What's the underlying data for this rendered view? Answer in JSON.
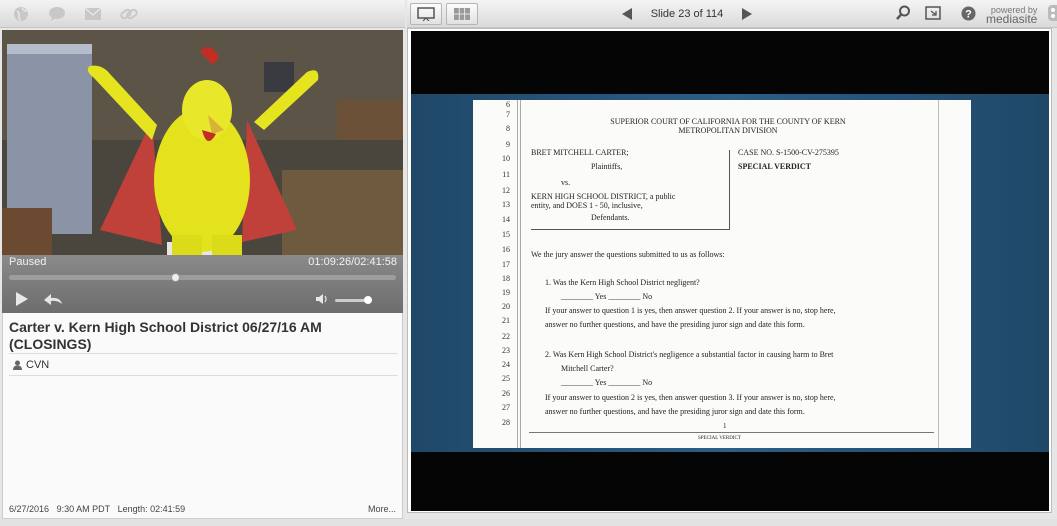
{
  "toolbar_left": {
    "icons": [
      "globe-icon",
      "chat-icon",
      "email-icon",
      "link-icon"
    ]
  },
  "toolbar_right": {
    "slide_label": "Slide 23 of 114",
    "powered_by": "powered by",
    "brand": "mediasite"
  },
  "player": {
    "status": "Paused",
    "time": "01:09:26/02:41:58",
    "progress": 0.43,
    "volume": 0.85
  },
  "info": {
    "title": "Carter v. Kern High School District 06/27/16 AM (CLOSINGS)",
    "presenter": "CVN",
    "date": "6/27/2016",
    "time": "9:30 AM PDT",
    "length": "Length: 02:41:59",
    "more": "More..."
  },
  "slide": {
    "line_numbers": [
      "6",
      "7",
      "8",
      "9",
      "10",
      "11",
      "12",
      "13",
      "14",
      "15",
      "16",
      "17",
      "18",
      "19",
      "20",
      "21",
      "22",
      "23",
      "24",
      "25",
      "26",
      "27",
      "28"
    ],
    "court": "SUPERIOR COURT OF CALIFORNIA FOR THE COUNTY OF KERN",
    "division": "METROPOLITAN DIVISION",
    "plaintiff": "BRET MITCHELL CARTER;",
    "plaintiffs": "Plaintiffs,",
    "vs": "vs.",
    "defendant1": "KERN HIGH SCHOOL DISTRICT, a public",
    "defendant2": "entity, and DOES 1 - 50, inclusive,",
    "defendants": "Defendants.",
    "case_no": "CASE NO.  S-1500-CV-275395",
    "verdict": "SPECIAL VERDICT",
    "intro": "We the jury answer the questions submitted to us as follows:",
    "q1": "1.   Was the Kern High School District negligent?",
    "q1_answer": "________ Yes ________ No",
    "q1_instr1": "If your answer to question 1 is yes, then answer question 2.  If your answer is no, stop here,",
    "q1_instr2": "answer no further questions, and have the presiding juror sign and date this form.",
    "q2": "2.   Was Kern High School District's negligence a substantial factor in causing harm to Bret",
    "q2_cont": "Mitchell Carter?",
    "q2_answer": "________ Yes ________ No",
    "q2_instr1": "If your answer to question 2 is yes, then answer question 3.  If your answer is no, stop here,",
    "q2_instr2": "answer no further questions, and have the presiding juror sign and date this form.",
    "page_num": "1",
    "footer": "SPECIAL VERDICT"
  }
}
